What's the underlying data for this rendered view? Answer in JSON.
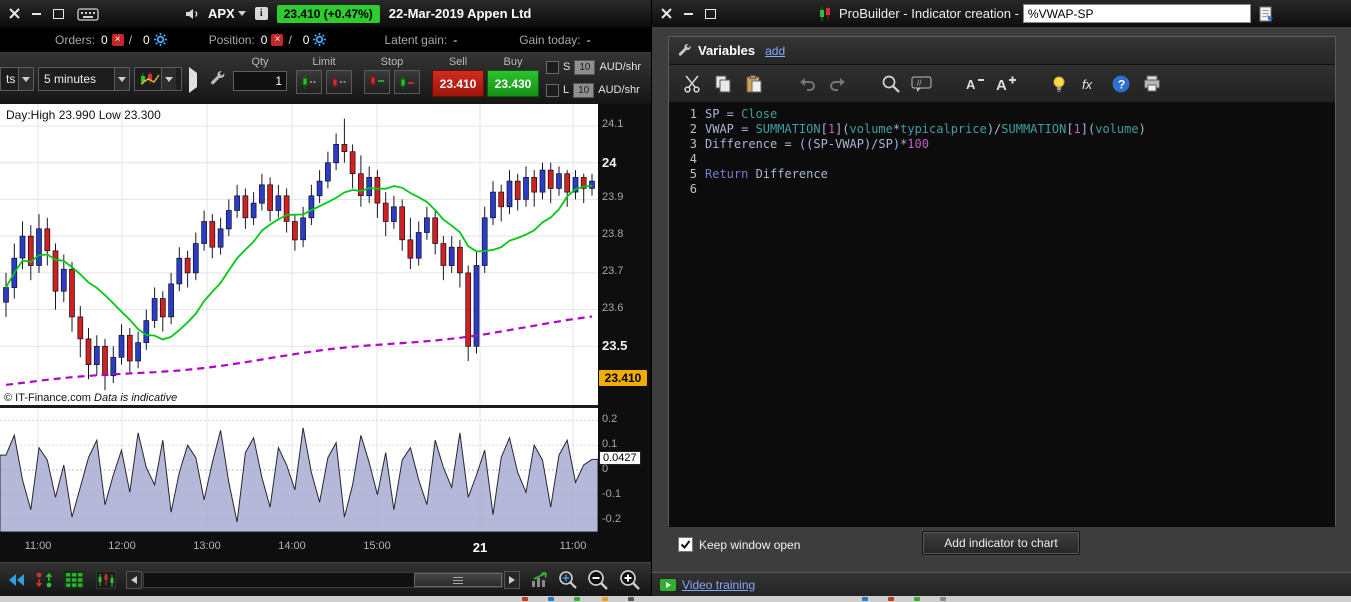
{
  "icons": {
    "fx": "fx",
    "help": "?",
    "comment": "//",
    "a_letter": "A",
    "cross": "×"
  },
  "left_window": {
    "titlebar": {
      "symbol": "APX",
      "info": "i",
      "price_badge": "23.410 (+0.47%)",
      "title": "22-Mar-2019 Appen Ltd"
    },
    "status": {
      "orders_label": "Orders:",
      "orders_count": "0",
      "orders_sep": "/",
      "orders_count2": "0",
      "position_label": "Position:",
      "position_count": "0",
      "position_sep": "/",
      "position_count2": "0",
      "latent_label": "Latent gain:",
      "latent_value": "-",
      "gain_label": "Gain today:",
      "gain_value": "-"
    },
    "toolbar": {
      "products_dropdown": "ts",
      "timeframe": "5 minutes",
      "qty_label": "Qty",
      "qty_value": "1",
      "limit_label": "Limit",
      "stop_label": "Stop",
      "sell_label": "Sell",
      "sell_price": "23.410",
      "buy_label": "Buy",
      "buy_price": "23.430",
      "short_label": "S",
      "short_amount": "10",
      "short_unit": "AUD/shr",
      "long_label": "L",
      "long_amount": "10",
      "long_unit": "AUD/shr"
    },
    "chart": {
      "day_range": "Day:High 23.990 Low 23.300",
      "copyright": "© IT-Finance.com",
      "indicative": "Data is indicative",
      "price_label": "23.410",
      "indicator_label": "0.0427"
    }
  },
  "right_window": {
    "titlebar": {
      "title": "ProBuilder - Indicator creation - ",
      "indicator_name": "%VWAP-SP"
    },
    "panel": {
      "header": "Variables",
      "add_link": "add"
    },
    "editor": {
      "lines": [
        {
          "num": "1",
          "tokens": [
            {
              "t": "SP = ",
              "c": "id"
            },
            {
              "t": "Close",
              "c": "kw"
            }
          ]
        },
        {
          "num": "2",
          "tokens": [
            {
              "t": "VWAP = ",
              "c": "id"
            },
            {
              "t": "SUMMATION",
              "c": "kw"
            },
            {
              "t": "[",
              "c": "id"
            },
            {
              "t": "1",
              "c": "num"
            },
            {
              "t": "](",
              "c": "id"
            },
            {
              "t": "volume",
              "c": "kw"
            },
            {
              "t": "*",
              "c": "id"
            },
            {
              "t": "typicalprice",
              "c": "kw"
            },
            {
              "t": ")/",
              "c": "id"
            },
            {
              "t": "SUMMATION",
              "c": "kw"
            },
            {
              "t": "[",
              "c": "id"
            },
            {
              "t": "1",
              "c": "num"
            },
            {
              "t": "](",
              "c": "id"
            },
            {
              "t": "volume",
              "c": "kw"
            },
            {
              "t": ")",
              "c": "id"
            }
          ]
        },
        {
          "num": "3",
          "tokens": [
            {
              "t": "Difference = ((SP-VWAP)/SP)*",
              "c": "id"
            },
            {
              "t": "100",
              "c": "num"
            }
          ]
        },
        {
          "num": "4",
          "tokens": []
        },
        {
          "num": "5",
          "tokens": [
            {
              "t": "Return",
              "c": "ret"
            },
            {
              "t": " Difference",
              "c": "id"
            }
          ]
        },
        {
          "num": "6",
          "tokens": []
        }
      ]
    },
    "footer": {
      "keep_open_label": "Keep window open",
      "add_button": "Add indicator to chart"
    },
    "video_link": "Video training"
  },
  "chart_data": {
    "type": "candlestick",
    "symbol": "APX",
    "session_title": "22-Mar-2019 Appen Ltd",
    "last_price": 23.41,
    "change_pct": "+0.47%",
    "day_high": 23.99,
    "day_low": 23.3,
    "timeframe": "5 minutes",
    "y_range": [
      23.34,
      24.16
    ],
    "y_ticks": [
      {
        "label": "24.1",
        "value": 24.1,
        "major": false
      },
      {
        "label": "24",
        "value": 24.0,
        "major": true
      },
      {
        "label": "23.9",
        "value": 23.9,
        "major": false
      },
      {
        "label": "23.8",
        "value": 23.8,
        "major": false
      },
      {
        "label": "23.7",
        "value": 23.7,
        "major": false
      },
      {
        "label": "23.6",
        "value": 23.6,
        "major": false
      },
      {
        "label": "23.5",
        "value": 23.5,
        "major": true
      }
    ],
    "x_ticks": [
      {
        "label": "11:00",
        "x": 38,
        "major": false
      },
      {
        "label": "12:00",
        "x": 122,
        "major": false
      },
      {
        "label": "13:00",
        "x": 207,
        "major": false
      },
      {
        "label": "14:00",
        "x": 292,
        "major": false
      },
      {
        "label": "15:00",
        "x": 377,
        "major": false
      },
      {
        "label": "21",
        "x": 480,
        "major": true
      },
      {
        "label": "11:00",
        "x": 573,
        "major": false
      }
    ],
    "up_color": "#2a3cc8",
    "down_color": "#d02020",
    "ma_color": "#00c814",
    "vwap_color": "#b400c8",
    "ma_period": 12,
    "vwap_start": 23.395,
    "vwap_end": 23.575,
    "candles": [
      [
        23.62,
        23.7,
        23.58,
        23.66
      ],
      [
        23.66,
        23.78,
        23.63,
        23.74
      ],
      [
        23.74,
        23.84,
        23.71,
        23.8
      ],
      [
        23.8,
        23.83,
        23.68,
        23.72
      ],
      [
        23.72,
        23.86,
        23.7,
        23.82
      ],
      [
        23.82,
        23.85,
        23.72,
        23.76
      ],
      [
        23.76,
        23.78,
        23.6,
        23.65
      ],
      [
        23.65,
        23.75,
        23.62,
        23.71
      ],
      [
        23.71,
        23.73,
        23.54,
        23.58
      ],
      [
        23.58,
        23.61,
        23.47,
        23.52
      ],
      [
        23.52,
        23.55,
        23.41,
        23.45
      ],
      [
        23.45,
        23.53,
        23.42,
        23.5
      ],
      [
        23.5,
        23.52,
        23.38,
        23.42
      ],
      [
        23.42,
        23.5,
        23.4,
        23.47
      ],
      [
        23.47,
        23.56,
        23.45,
        23.53
      ],
      [
        23.53,
        23.55,
        23.43,
        23.46
      ],
      [
        23.46,
        23.54,
        23.44,
        23.51
      ],
      [
        23.51,
        23.6,
        23.49,
        23.57
      ],
      [
        23.57,
        23.66,
        23.55,
        23.63
      ],
      [
        23.63,
        23.65,
        23.54,
        23.58
      ],
      [
        23.58,
        23.7,
        23.56,
        23.67
      ],
      [
        23.67,
        23.77,
        23.65,
        23.74
      ],
      [
        23.74,
        23.76,
        23.66,
        23.7
      ],
      [
        23.7,
        23.81,
        23.68,
        23.78
      ],
      [
        23.78,
        23.87,
        23.76,
        23.84
      ],
      [
        23.84,
        23.86,
        23.74,
        23.77
      ],
      [
        23.77,
        23.85,
        23.75,
        23.82
      ],
      [
        23.82,
        23.9,
        23.8,
        23.87
      ],
      [
        23.87,
        23.94,
        23.85,
        23.91
      ],
      [
        23.91,
        23.93,
        23.82,
        23.85
      ],
      [
        23.85,
        23.92,
        23.83,
        23.89
      ],
      [
        23.89,
        23.97,
        23.87,
        23.94
      ],
      [
        23.94,
        23.96,
        23.84,
        23.87
      ],
      [
        23.87,
        23.94,
        23.85,
        23.91
      ],
      [
        23.91,
        23.93,
        23.81,
        23.84
      ],
      [
        23.84,
        23.86,
        23.76,
        23.79
      ],
      [
        23.79,
        23.88,
        23.77,
        23.85
      ],
      [
        23.85,
        23.94,
        23.83,
        23.91
      ],
      [
        23.91,
        23.98,
        23.89,
        23.95
      ],
      [
        23.95,
        24.03,
        23.93,
        24.0
      ],
      [
        24.0,
        24.08,
        23.98,
        24.05
      ],
      [
        24.05,
        24.12,
        24.0,
        24.03
      ],
      [
        24.03,
        24.05,
        23.93,
        23.97
      ],
      [
        23.97,
        24.02,
        23.88,
        23.91
      ],
      [
        23.91,
        23.99,
        23.89,
        23.96
      ],
      [
        23.96,
        23.98,
        23.85,
        23.89
      ],
      [
        23.89,
        23.92,
        23.8,
        23.84
      ],
      [
        23.84,
        23.91,
        23.82,
        23.88
      ],
      [
        23.88,
        23.9,
        23.76,
        23.79
      ],
      [
        23.79,
        23.85,
        23.71,
        23.74
      ],
      [
        23.74,
        23.84,
        23.72,
        23.81
      ],
      [
        23.81,
        23.88,
        23.79,
        23.85
      ],
      [
        23.85,
        23.87,
        23.75,
        23.78
      ],
      [
        23.78,
        23.8,
        23.68,
        23.72
      ],
      [
        23.72,
        23.8,
        23.7,
        23.77
      ],
      [
        23.77,
        23.79,
        23.66,
        23.7
      ],
      [
        23.7,
        23.72,
        23.46,
        23.5
      ],
      [
        23.5,
        23.76,
        23.48,
        23.72
      ],
      [
        23.72,
        23.88,
        23.7,
        23.85
      ],
      [
        23.85,
        23.95,
        23.83,
        23.92
      ],
      [
        23.92,
        23.94,
        23.84,
        23.88
      ],
      [
        23.88,
        23.98,
        23.86,
        23.95
      ],
      [
        23.95,
        23.97,
        23.87,
        23.9
      ],
      [
        23.9,
        23.99,
        23.88,
        23.96
      ],
      [
        23.96,
        23.98,
        23.88,
        23.92
      ],
      [
        23.92,
        24.0,
        23.9,
        23.98
      ],
      [
        23.98,
        24.0,
        23.89,
        23.93
      ],
      [
        23.93,
        23.99,
        23.91,
        23.97
      ],
      [
        23.97,
        23.98,
        23.88,
        23.92
      ],
      [
        23.92,
        23.98,
        23.9,
        23.96
      ],
      [
        23.96,
        23.97,
        23.89,
        23.93
      ],
      [
        23.93,
        23.97,
        23.91,
        23.95
      ]
    ],
    "indicator": {
      "name": "%VWAP-SP",
      "last_value": 0.0427,
      "fill_color": "#a9abd4",
      "y_range": [
        -0.25,
        0.25
      ],
      "y_ticks": [
        {
          "label": "0.2",
          "value": 0.2
        },
        {
          "label": "0.1",
          "value": 0.1
        },
        {
          "label": "0",
          "value": 0
        },
        {
          "label": "-0.1",
          "value": -0.1
        },
        {
          "label": "-0.2",
          "value": -0.2
        }
      ],
      "values": [
        0.06,
        0.14,
        -0.04,
        -0.16,
        0.09,
        0.04,
        -0.11,
        0.02,
        -0.19,
        -0.07,
        0.05,
        0.12,
        -0.14,
        -0.02,
        0.08,
        -0.09,
        0.15,
        0.01,
        -0.06,
        0.12,
        -0.17,
        -0.01,
        0.1,
        0.05,
        -0.12,
        0.03,
        0.16,
        -0.05,
        -0.21,
        0.07,
        0.13,
        -0.03,
        -0.15,
        0.09,
        0.02,
        -0.08,
        0.17,
        -0.01,
        -0.13,
        0.05,
        0.11,
        -0.19,
        -0.06,
        0.14,
        0.03,
        -0.1,
        0.07,
        -0.16,
        0.04,
        0.09,
        -0.04,
        -0.14,
        0.12,
        0.01,
        -0.07,
        0.15,
        -0.11,
        -0.02,
        0.08,
        -0.18,
        0.05,
        0.13,
        -0.01,
        -0.09,
        0.1,
        0.04,
        -0.15,
        0.06,
        0.12,
        -0.05,
        0.02,
        0.0427
      ]
    }
  }
}
